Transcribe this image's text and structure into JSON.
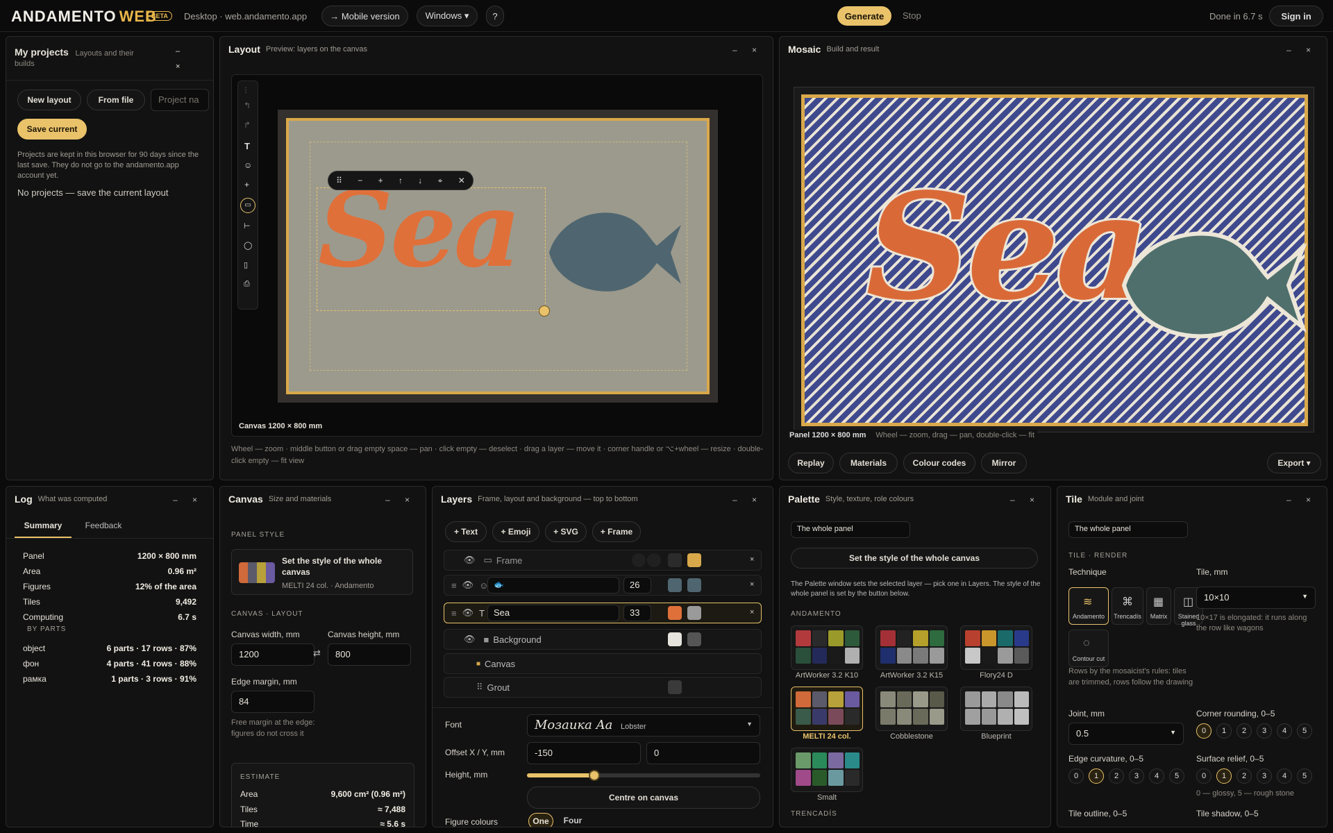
{
  "top": {
    "logo": "ANDAMENTO",
    "logo_web": "WEB",
    "beta": "BETA",
    "crumb": "Desktop · web.andamento.app",
    "mobile": "→ Mobile version",
    "windows": "Windows ▾",
    "help": "?",
    "generate": "Generate",
    "stop": "Stop",
    "done": "Done in 6.7 s",
    "signin": "Sign in"
  },
  "projects": {
    "title": "My projects",
    "subtitle": "Layouts and their builds",
    "new": "New layout",
    "file": "From file",
    "name_ph": "Project na",
    "save": "Save current",
    "note": "Projects are kept in this browser for 90 days since the last save. They do not go to the andamento.app account yet.",
    "empty": "No projects — save the current layout"
  },
  "layout": {
    "title": "Layout",
    "subtitle": "Preview: layers on the canvas",
    "canvas_label": "Canvas 1200 × 800 mm",
    "hint": "Wheel — zoom · middle button or drag empty space — pan · click empty — deselect · drag a layer — move it · corner handle or ⌥+wheel — resize · double-click empty — fit view",
    "sea": "Sea"
  },
  "mosaic": {
    "title": "Mosaic",
    "subtitle": "Build and result",
    "panel_label": "Panel 1200 × 800 mm",
    "hint": "Wheel — zoom, drag — pan, double-click — fit",
    "replay": "Replay",
    "materials": "Materials",
    "colour_codes": "Colour codes",
    "mirror": "Mirror",
    "export": "Export ▾",
    "sea": "Sea"
  },
  "log": {
    "title": "Log",
    "subtitle": "What was computed",
    "tab_summary": "Summary",
    "tab_feedback": "Feedback",
    "rows": [
      {
        "k": "Panel",
        "v": "1200 × 800 mm"
      },
      {
        "k": "Area",
        "v": "0.96 m²"
      },
      {
        "k": "Figures",
        "v": "12% of the area"
      },
      {
        "k": "Tiles",
        "v": "9,492"
      },
      {
        "k": "Computing",
        "v": "6.7 s"
      }
    ],
    "by_parts": "BY PARTS",
    "parts": [
      {
        "k": "object",
        "v": "6 parts · 17 rows · 87%"
      },
      {
        "k": "фон",
        "v": "4 parts · 41 rows · 88%"
      },
      {
        "k": "рамка",
        "v": "1 parts · 3 rows · 91%"
      }
    ]
  },
  "canvas": {
    "title": "Canvas",
    "subtitle": "Size and materials",
    "panel_style": "PANEL STYLE",
    "style_title": "Set the style of the whole canvas",
    "style_sub": "MELTI 24 col. · Andamento",
    "layout_sect": "CANVAS · LAYOUT",
    "w_label": "Canvas width, mm",
    "h_label": "Canvas height, mm",
    "w": "1200",
    "h": "800",
    "swap": "⇄",
    "margin_label": "Edge margin, mm",
    "margin": "84",
    "margin_note": "Free margin at the edge: figures do not cross it",
    "estimate": "ESTIMATE",
    "est": [
      {
        "k": "Area",
        "v": "9,600 cm² (0.96 m²)"
      },
      {
        "k": "Tiles",
        "v": "≈ 7,488"
      },
      {
        "k": "Time",
        "v": "≈ 5.6 s"
      }
    ]
  },
  "layers": {
    "title": "Layers",
    "subtitle": "Frame, layout and background — top to bottom",
    "add_text": "+ Text",
    "add_emoji": "+ Emoji",
    "add_svg": "+ SVG",
    "add_frame": "+ Frame",
    "frame": "Frame",
    "emoji_val": "🐟",
    "emoji_size": "26",
    "text_val": "Sea",
    "text_size": "33",
    "background": "Background",
    "canvas": "Canvas",
    "grout": "Grout",
    "font_label": "Font",
    "font_preview": "Мозаика Aa",
    "font_name": "Lobster",
    "offset_label": "Offset X / Y, mm",
    "offset_x": "-150",
    "offset_y": "0",
    "height_label": "Height, mm",
    "height_value": 0.29,
    "centre": "Centre on canvas",
    "fig_label": "Figure colours",
    "one": "One",
    "four": "Four"
  },
  "palette": {
    "title": "Palette",
    "subtitle": "Style, texture, role colours",
    "scope": "The whole panel",
    "set_style": "Set the style of the whole canvas",
    "note": "The Palette window sets the selected layer — pick one in Layers. The style of the whole panel is set by the button below.",
    "andamento": "ANDAMENTO",
    "trencadis": "TRENCADÍS",
    "sets": [
      {
        "name": "ArtWorker 3.2 K10",
        "colors": [
          "#b23a3c",
          "#2a2a2a",
          "#9a9a2a",
          "#2d5a3a",
          "#2a4f3a",
          "#232a5a",
          "#1a1a1a",
          "#b0b0b0"
        ]
      },
      {
        "name": "ArtWorker 3.2 K15",
        "colors": [
          "#a33036",
          "#222",
          "#b4a02a",
          "#2e6b3e",
          "#1f2f6e",
          "#8a8a8a",
          "#7a7a7a",
          "#9a9a9a"
        ]
      },
      {
        "name": "Flory24 D",
        "colors": [
          "#b8402e",
          "#c8962a",
          "#1a6a6a",
          "#2a3a8a",
          "#c8c8c8",
          "#1a1a1a",
          "#9a9a9a",
          "#5a5a5a"
        ]
      },
      {
        "name": "MELTI 24 col.",
        "colors": [
          "#d06a3a",
          "#5a5a6a",
          "#b8a03a",
          "#6a5aa0",
          "#3a5a4a",
          "#3a3a6a",
          "#7a4a5a",
          "#2a2a2a"
        ]
      },
      {
        "name": "Cobblestone",
        "colors": [
          "#8a8a7a",
          "#6a6a5a",
          "#9a9a8a",
          "#5a5a4a",
          "#7a7a6a",
          "#8a8a7a",
          "#6a6a5a",
          "#9a9a8a"
        ]
      },
      {
        "name": "Blueprint",
        "colors": [
          "#9a9a9a",
          "#aaaaaa",
          "#8a8a8a",
          "#bbbbbb",
          "#a0a0a0",
          "#999999",
          "#b0b0b0",
          "#c0c0c0"
        ]
      },
      {
        "name": "Smalt",
        "colors": [
          "#6a9a6a",
          "#2a8a5a",
          "#7a6aa0",
          "#2a8a8a",
          "#a04a8a",
          "#2a5a2a",
          "#6a9aa0",
          "#2a2a2a"
        ]
      }
    ]
  },
  "tile": {
    "title": "Tile",
    "subtitle": "Module and joint",
    "scope": "The whole panel",
    "render": "TILE · RENDER",
    "technique": "Technique",
    "tile_mm": "Tile, mm",
    "tile_val": "10×10",
    "elong": "10×17 is elongated: it runs along the row like wagons",
    "techs": [
      "Andamento",
      "Trencadís",
      "Matrix",
      "Stained glass",
      "Contour cut"
    ],
    "rules": "Rows by the mosaicist's rules: tiles are trimmed, rows follow the drawing",
    "joint": "Joint, mm",
    "joint_val": "0.5",
    "corner": "Corner rounding, 0–5",
    "edge": "Edge curvature, 0–5",
    "relief": "Surface relief, 0–5",
    "relief_note": "0 — glossy, 5 — rough stone",
    "outline": "Tile outline, 0–5",
    "shadow": "Tile shadow, 0–5"
  },
  "colors": {
    "accent": "#e9c26a",
    "orange": "#e0703a",
    "fish": "#4f6670",
    "canvas_bg": "#9c9a8d",
    "frame": "#d9a84a",
    "navy": "#3f4a8e"
  }
}
